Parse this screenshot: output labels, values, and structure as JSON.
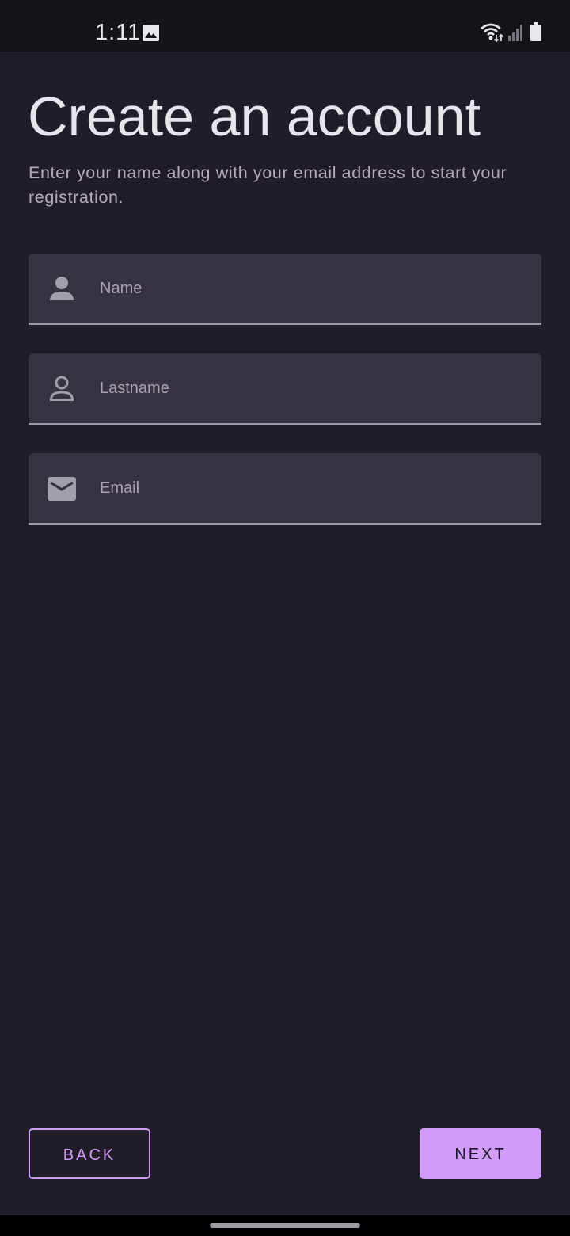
{
  "status_bar": {
    "time": "1:11",
    "icons": [
      "gallery-icon",
      "wifi-icon",
      "signal-icon",
      "battery-icon"
    ]
  },
  "header": {
    "title": "Create an account",
    "subtitle": "Enter your name along with your email address to start your registration."
  },
  "form": {
    "name": {
      "placeholder": "Name",
      "value": "",
      "icon": "person-filled-icon"
    },
    "lastname": {
      "placeholder": "Lastname",
      "value": "",
      "icon": "person-outline-icon"
    },
    "email": {
      "placeholder": "Email",
      "value": "",
      "icon": "mail-icon"
    }
  },
  "actions": {
    "back_label": "BACK",
    "next_label": "NEXT"
  },
  "colors": {
    "background": "#211d28",
    "field_background": "#37323f",
    "accent": "#d19df9",
    "title_text": "#e7e4ec",
    "secondary_text": "#b3adbb"
  }
}
